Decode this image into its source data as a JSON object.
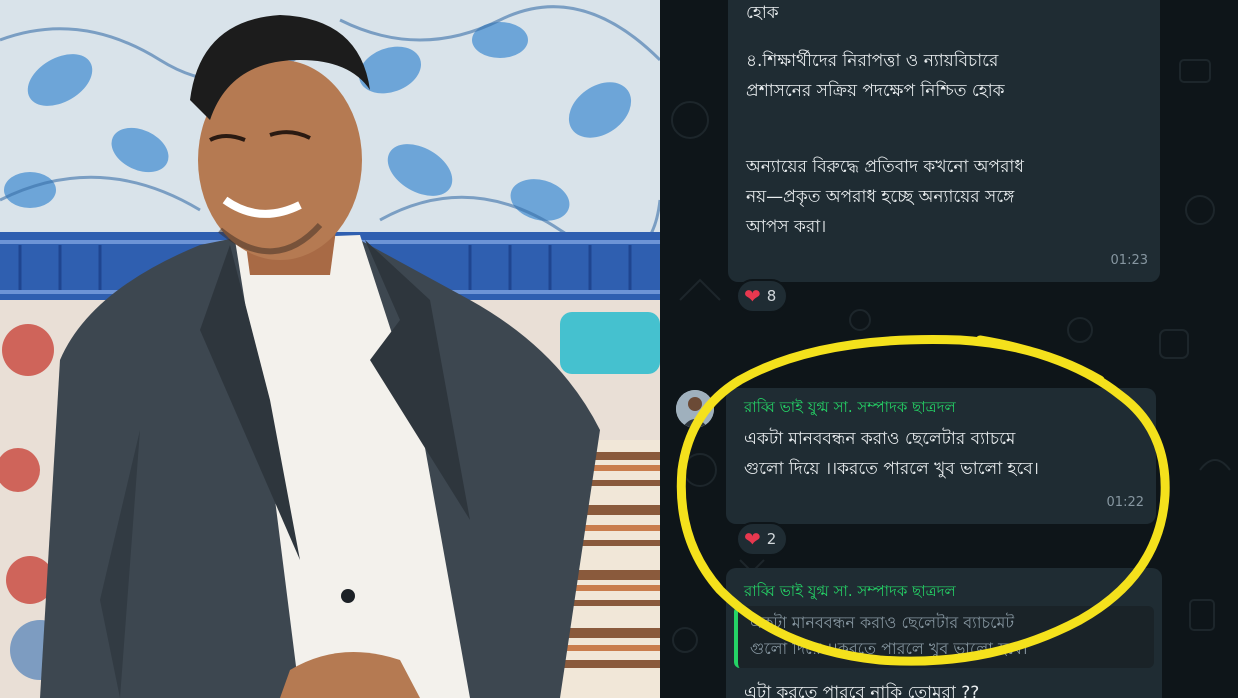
{
  "chat": {
    "message1": {
      "text_top": "হোক",
      "text_point4": "৪.শিক্ষার্থীদের নিরাপত্তা ও ন্যায়বিচারে\nপ্রশাসনের সক্রিয় পদক্ষেপ নিশ্চিত হোক",
      "text_quote": "অন্যায়ের বিরুদ্ধে প্রতিবাদ কখনো অপরাধ\nনয়—প্রকৃত অপরাধ হচ্ছে অন্যায়ের সঙ্গে\nআপস করা।",
      "time": "01:23",
      "reaction_count": "8"
    },
    "message2": {
      "sender": "রাব্বি ভাই যুগ্ম সা. সম্পাদক ছাত্রদল",
      "text": "একটা মানববন্ধন করাও ছেলেটার ব্যাচমে\nগুলো দিয়ে ।।করতে পারলে খুব ভালো হবে।",
      "time": "01:22",
      "reaction_count": "2"
    },
    "message3": {
      "sender": "রাব্বি ভাই যুগ্ম সা. সম্পাদক ছাত্রদল",
      "quoted_text": "একটা মানববন্ধন করাও ছেলেটার ব্যাচমেট\nগুলো দিয়ে ।।করতে পারলে খুব ভালো হবে।",
      "reply_text": "এটা করতে পারবে নাকি তোমরা ??"
    }
  },
  "colors": {
    "chat_background": "#0e1519",
    "bubble": "#1f2c33",
    "sender_name": "#25d366",
    "highlight_circle": "#f4e11c",
    "heart": "#e8384f"
  },
  "icons": [
    "heart-reaction-icon",
    "avatar-icon"
  ]
}
